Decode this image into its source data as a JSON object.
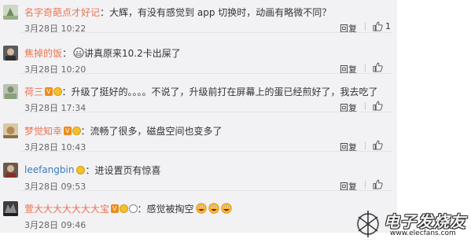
{
  "comments": [
    {
      "username": "名字奇葩点才好记",
      "colon": "：",
      "text": "大辉，有没有感觉到 app 切换时，动画有略微不同？",
      "time": "3月28日 10:22",
      "reply": "回复",
      "likes": "1"
    },
    {
      "username": "焦掉的饭",
      "colon": "：",
      "text": "讲真原来10.2卡出屎了",
      "time": "3月28日 10:20",
      "reply": "回复",
      "likes": ""
    },
    {
      "username": "荷三",
      "badge_text": "V",
      "colon": "：",
      "text": "升级了挺好的。。。。不说了，升级前打在屏幕上的蛋已经煎好了，我去吃了",
      "time": "3月28日 17:34",
      "reply": "回复",
      "likes": ""
    },
    {
      "username": "梦觉知幸",
      "badge_text": "V",
      "colon": "：",
      "text": "流畅了很多，磁盘空间也变多了",
      "time": "3月28日 10:43",
      "reply": "回复",
      "likes": ""
    },
    {
      "username": "leefangbin",
      "colon": "：",
      "text": "进设置页有惊喜",
      "time": "3月28日 09:53",
      "reply": "回复",
      "likes": ""
    },
    {
      "username": "萱大大大大大大大宝",
      "badge_text": "V",
      "colon": "：",
      "text": "感觉被掏空",
      "time": "3月28日 09:46",
      "reply": "回复",
      "likes": ""
    }
  ],
  "watermark": {
    "title": "电子发烧友",
    "url": "www.elecfans.com"
  },
  "colors": {
    "username": "#eb7350",
    "panel_bg": "#f2f2f5",
    "vip_badge": "#ef8a1a"
  }
}
